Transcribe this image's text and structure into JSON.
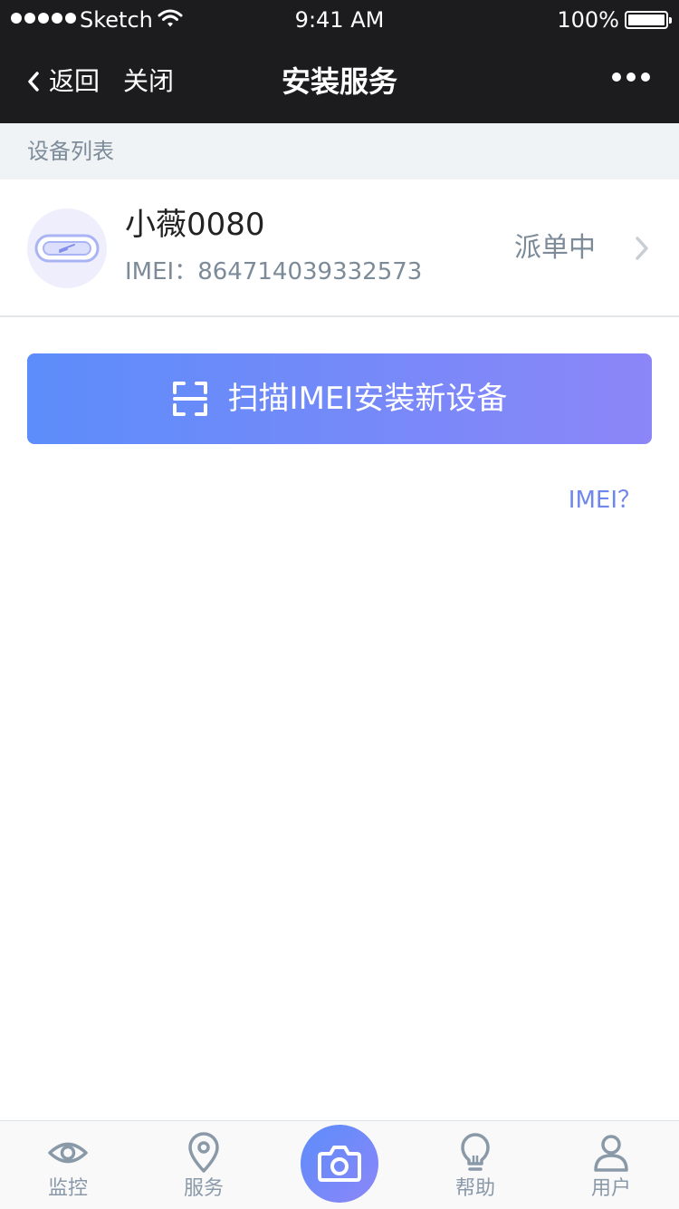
{
  "status_bar": {
    "carrier": "Sketch",
    "time": "9:41 AM",
    "battery": "100%"
  },
  "nav": {
    "back_label": "返回",
    "close_label": "关闭",
    "title": "安装服务"
  },
  "section": {
    "title": "设备列表"
  },
  "device": {
    "name": "小薇0080",
    "imei": "IMEI：864714039332573",
    "status": "派单中"
  },
  "scan_button": {
    "label": "扫描IMEI安装新设备"
  },
  "imei_help": "IMEI？",
  "tabs": [
    {
      "label": "监控",
      "icon": "eye-icon"
    },
    {
      "label": "服务",
      "icon": "location-pin-icon"
    },
    {
      "label": "",
      "icon": "camera-icon"
    },
    {
      "label": "帮助",
      "icon": "lightbulb-icon"
    },
    {
      "label": "用户",
      "icon": "user-icon"
    }
  ],
  "colors": {
    "nav_bg": "#1c1c1e",
    "accent_start": "#5c8dfa",
    "accent_end": "#8c86f8",
    "muted_text": "#7d8b99",
    "link": "#6f86ee"
  }
}
